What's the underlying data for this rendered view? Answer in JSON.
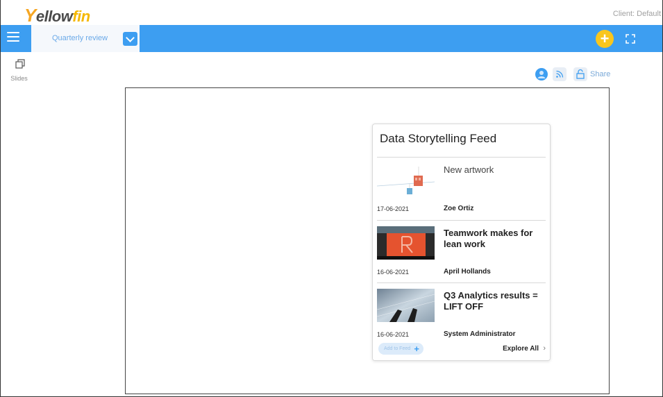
{
  "header": {
    "logo_y": "Y",
    "logo_ellow": "ellow",
    "logo_fin": "fin",
    "client_label": "Client: Default"
  },
  "navbar": {
    "tab_label": "Quarterly review",
    "add_icon": "plus-icon",
    "fullscreen_icon": "fullscreen-icon"
  },
  "sidebar": {
    "slides_label": "Slides"
  },
  "toolbar": {
    "share_label": "Share"
  },
  "feed": {
    "title": "Data Storytelling Feed",
    "stories": [
      {
        "title": "New artwork",
        "date": "17-06-2021",
        "author": "Zoe Ortiz"
      },
      {
        "title": "Teamwork makes for lean work",
        "date": "16-06-2021",
        "author": "April Hollands"
      },
      {
        "title": "Q3 Analytics results = LIFT OFF",
        "date": "16-06-2021",
        "author": "System Administrator"
      }
    ],
    "add_to_feed_label": "Add to Feed",
    "explore_all_label": "Explore All"
  },
  "colors": {
    "accent": "#3d9ef1",
    "add_button": "#f9c61e",
    "logo_yellow": "#f5b800"
  }
}
